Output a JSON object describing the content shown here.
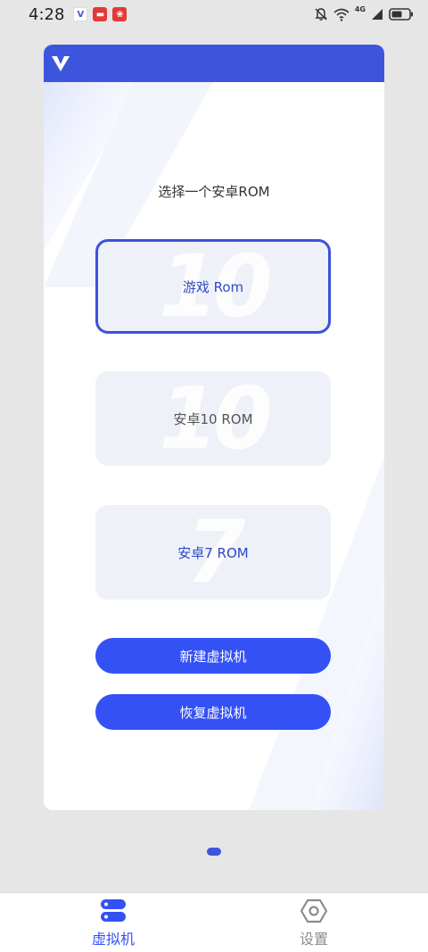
{
  "status_bar": {
    "time": "4:28",
    "network": "4G"
  },
  "main": {
    "prompt": "选择一个安卓ROM",
    "rom_options": [
      {
        "label": "游戏 Rom",
        "watermark": "10",
        "selected": true
      },
      {
        "label": "安卓10 ROM",
        "watermark": "10",
        "selected": false
      },
      {
        "label": "安卓7 ROM",
        "watermark": "7",
        "selected": false
      }
    ],
    "buttons": {
      "new_vm": "新建虚拟机",
      "restore_vm": "恢复虚拟机"
    }
  },
  "bottom_nav": {
    "items": [
      {
        "label": "虚拟机",
        "icon": "server-stack-icon",
        "active": true
      },
      {
        "label": "设置",
        "icon": "hexagon-gear-icon",
        "active": false
      }
    ]
  },
  "colors": {
    "accent": "#3d55dd",
    "button": "#3451f5",
    "selected_text": "#2f48c8",
    "inactive": "#8c8c8c"
  }
}
